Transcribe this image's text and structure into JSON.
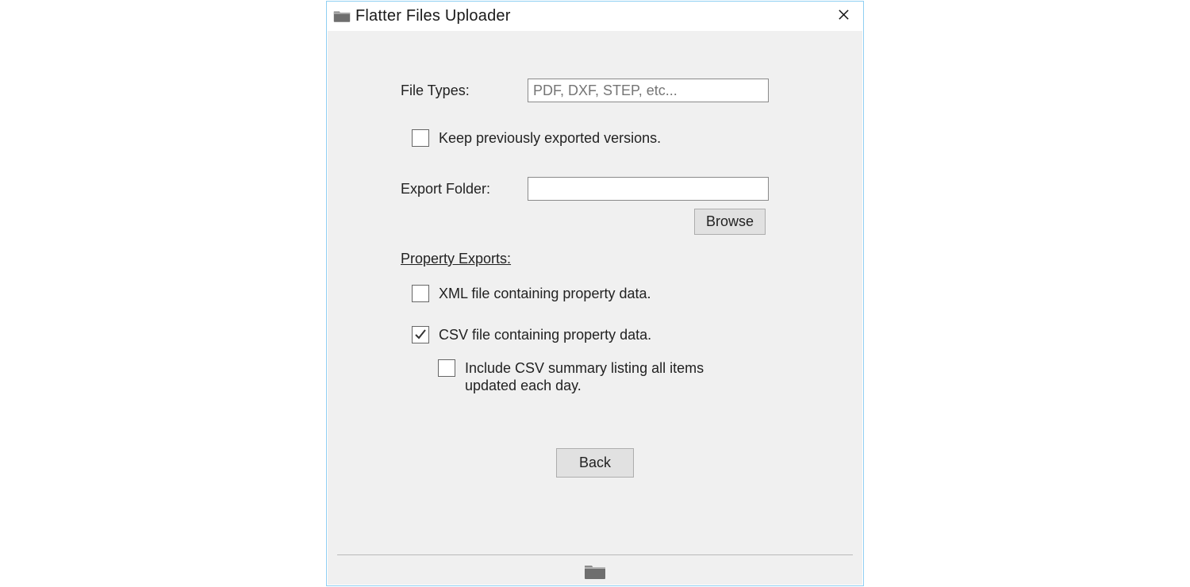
{
  "window": {
    "title": "Flatter Files Uploader"
  },
  "form": {
    "file_types_label": "File Types:",
    "file_types_placeholder": "PDF, DXF, STEP, etc...",
    "file_types_value": "",
    "keep_previous_label": "Keep previously exported versions.",
    "keep_previous_checked": false,
    "export_folder_label": "Export Folder:",
    "export_folder_value": "",
    "browse_label": "Browse",
    "property_exports_header": "Property Exports:",
    "xml_prop_label": "XML file containing property data.",
    "xml_prop_checked": false,
    "csv_prop_label": "CSV file containing property data.",
    "csv_prop_checked": true,
    "csv_summary_label": "Include CSV summary listing all items updated each day.",
    "csv_summary_checked": false,
    "back_label": "Back"
  }
}
